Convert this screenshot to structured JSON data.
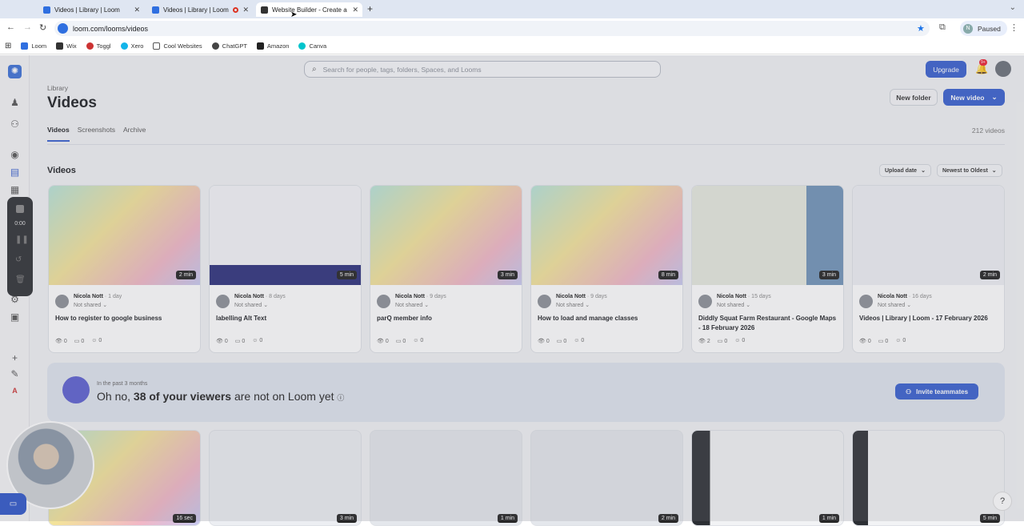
{
  "browser": {
    "tabs": [
      {
        "title": "Videos | Library | Loom"
      },
      {
        "title": "Videos | Library | Loom"
      },
      {
        "title": "Website Builder - Create a Fr"
      }
    ],
    "url": "loom.com/looms/videos",
    "profile_initial": "N",
    "profile_status": "Paused",
    "bookmarks": [
      "Loom",
      "Wix",
      "Toggl",
      "Xero",
      "Cool Websites",
      "ChatGPT",
      "Amazon",
      "Canva"
    ]
  },
  "header": {
    "search_placeholder": "Search for people, tags, folders, Spaces, and Looms",
    "upgrade_label": "Upgrade",
    "notification_count": "9+"
  },
  "page": {
    "breadcrumb": "Library",
    "title": "Videos",
    "new_folder_label": "New folder",
    "new_video_label": "New video",
    "tabs": [
      "Videos",
      "Screenshots",
      "Archive"
    ],
    "video_count": "212 videos",
    "section_title": "Videos",
    "sort_field": "Upload date",
    "sort_order": "Newest to Oldest"
  },
  "recorder": {
    "time": "0:00"
  },
  "videos": [
    {
      "owner": "Nicola Nott",
      "age": "· 1 day",
      "shared": "Not shared",
      "title": "How to register to google business",
      "duration": "2 min",
      "views": "0",
      "comments": "0",
      "reactions": "0"
    },
    {
      "owner": "Nicola Nott",
      "age": "· 8 days",
      "shared": "Not shared",
      "title": "labelling Alt Text",
      "duration": "5 min",
      "views": "0",
      "comments": "0",
      "reactions": "0"
    },
    {
      "owner": "Nicola Nott",
      "age": "· 9 days",
      "shared": "Not shared",
      "title": "parQ member info",
      "duration": "3 min",
      "views": "0",
      "comments": "0",
      "reactions": "0"
    },
    {
      "owner": "Nicola Nott",
      "age": "· 9 days",
      "shared": "Not shared",
      "title": "How to load and manage classes",
      "duration": "8 min",
      "views": "0",
      "comments": "0",
      "reactions": "0"
    },
    {
      "owner": "Nicola Nott",
      "age": "· 15 days",
      "shared": "Not shared",
      "title": "Diddly Squat Farm Restaurant - Google Maps - 18 February 2026",
      "duration": "3 min",
      "views": "2",
      "comments": "0",
      "reactions": "0"
    },
    {
      "owner": "Nicola Nott",
      "age": "· 16 days",
      "shared": "Not shared",
      "title": "Videos | Library | Loom - 17 February 2026",
      "duration": "2 min",
      "views": "0",
      "comments": "0",
      "reactions": "0"
    }
  ],
  "banner": {
    "small": "In the past 3 months",
    "prefix": "Oh no, ",
    "highlight": "38 of your viewers",
    "suffix": " are not on Loom yet",
    "invite_label": "Invite teammates"
  },
  "videos_row2": [
    {
      "duration": "16 sec"
    },
    {
      "duration": "3 min"
    },
    {
      "duration": "1 min"
    },
    {
      "duration": "2 min"
    },
    {
      "duration": "1 min"
    },
    {
      "duration": "5 min"
    }
  ]
}
